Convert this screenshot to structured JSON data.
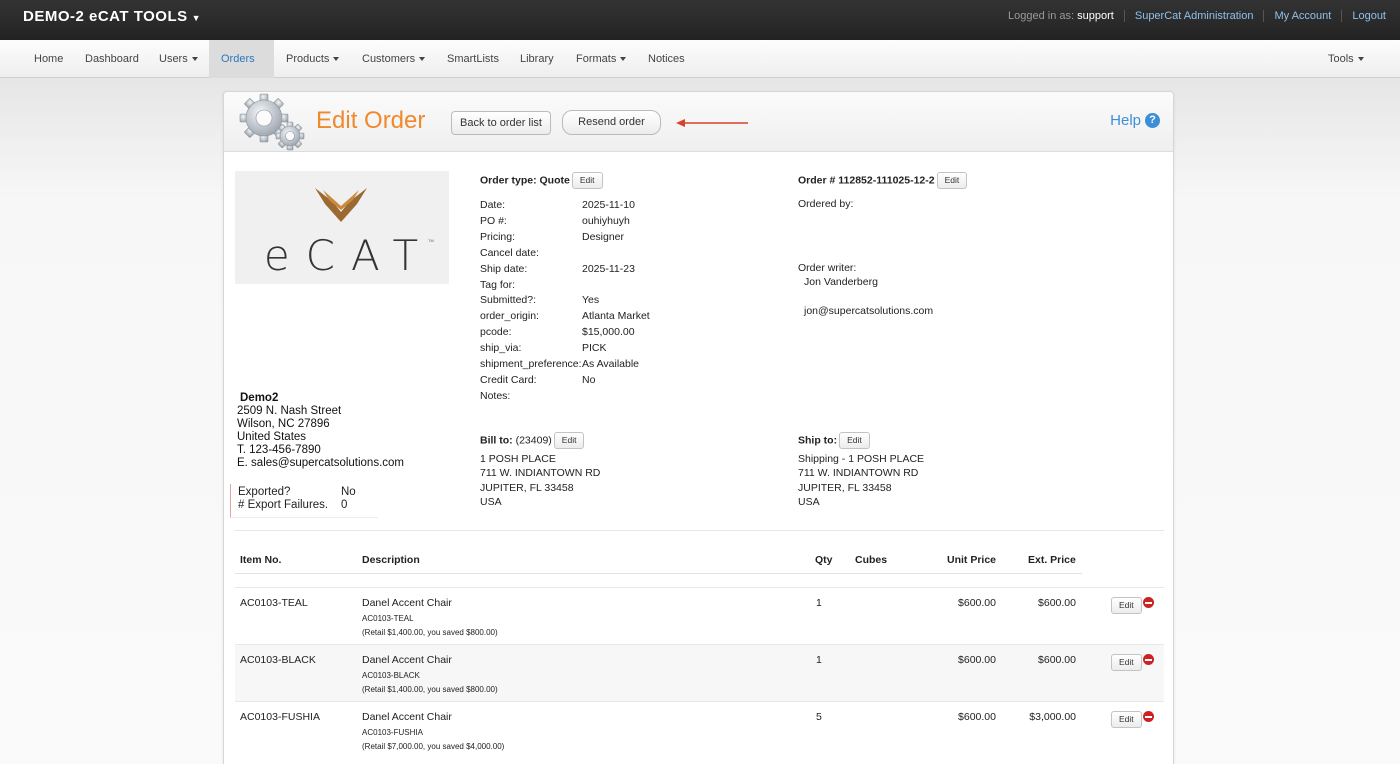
{
  "app": {
    "title": "DEMO-2 eCAT TOOLS"
  },
  "top_links": {
    "logged_in_prefix": "Logged in as:",
    "user": "support",
    "admin": "SuperCat Administration",
    "account": "My Account",
    "logout": "Logout"
  },
  "nav": {
    "home": "Home",
    "dashboard": "Dashboard",
    "users": "Users",
    "orders": "Orders",
    "products": "Products",
    "customers": "Customers",
    "smartlists": "SmartLists",
    "library": "Library",
    "formats": "Formats",
    "notices": "Notices",
    "tools": "Tools"
  },
  "header": {
    "title": "Edit Order",
    "back_label": "Back to order list",
    "resend_label": "Resend order",
    "help_label": "Help"
  },
  "logo": {
    "text": "eCAT",
    "tm": "TM"
  },
  "company": {
    "name": "Demo2",
    "street": "2509 N. Nash Street",
    "city": "Wilson, NC 27896",
    "country": "United States",
    "phone": "T. 123-456-7890",
    "email": "E. sales@supercatsolutions.com"
  },
  "export": {
    "exported_label": "Exported?",
    "exported_value": "No",
    "failures_label": "# Export Failures.",
    "failures_value": "0"
  },
  "order_type": {
    "label": "Order type: Quote",
    "edit": "Edit"
  },
  "details": [
    {
      "k": "Date:",
      "v": "2025-11-10"
    },
    {
      "k": "PO #:",
      "v": "ouhiyhuyh"
    },
    {
      "k": "Pricing:",
      "v": "Designer"
    },
    {
      "k": "Cancel date:",
      "v": ""
    },
    {
      "k": "Ship date:",
      "v": "2025-11-23"
    },
    {
      "k": "Tag for:",
      "v": ""
    },
    {
      "k": "Submitted?:",
      "v": "Yes"
    },
    {
      "k": "order_origin:",
      "v": "Atlanta Market"
    },
    {
      "k": "pcode:",
      "v": "$15,000.00"
    },
    {
      "k": "ship_via:",
      "v": "PICK"
    },
    {
      "k": "shipment_preference:",
      "v": "As Available"
    },
    {
      "k": "Credit Card:",
      "v": "No"
    },
    {
      "k": "Notes:",
      "v": ""
    }
  ],
  "order_num": {
    "label": "Order # 112852-111025-12-2",
    "edit": "Edit"
  },
  "ordered_by": {
    "label": "Ordered by:"
  },
  "order_writer": {
    "label": "Order writer:",
    "name": "Jon Vanderberg",
    "email": "jon@supercatsolutions.com"
  },
  "bill_to": {
    "label": "Bill to:",
    "account": "(23409)",
    "edit": "Edit",
    "line1": "1 POSH PLACE",
    "line2": "711 W. INDIANTOWN RD",
    "line3": "JUPITER, FL 33458",
    "line4": "USA"
  },
  "ship_to": {
    "label": "Ship to:",
    "edit": "Edit",
    "line1": "Shipping - 1 POSH PLACE",
    "line2": "711 W. INDIANTOWN RD",
    "line3": "JUPITER, FL 33458",
    "line4": "USA"
  },
  "table": {
    "headers": {
      "item": "Item No.",
      "desc": "Description",
      "qty": "Qty",
      "cubes": "Cubes",
      "unit": "Unit Price",
      "ext": "Ext. Price"
    },
    "edit_label": "Edit",
    "rows": [
      {
        "item": "AC0103-TEAL",
        "name": "Danel Accent Chair",
        "sku": "AC0103-TEAL",
        "retail": "(Retail $1,400.00, you saved $800.00)",
        "qty": "1",
        "cubes": "",
        "unit": "$600.00",
        "ext": "$600.00"
      },
      {
        "item": "AC0103-BLACK",
        "name": "Danel Accent Chair",
        "sku": "AC0103-BLACK",
        "retail": "(Retail $1,400.00, you saved $800.00)",
        "qty": "1",
        "cubes": "",
        "unit": "$600.00",
        "ext": "$600.00"
      },
      {
        "item": "AC0103-FUSHIA",
        "name": "Danel Accent Chair",
        "sku": "AC0103-FUSHIA",
        "retail": "(Retail $7,000.00, you saved $4,000.00)",
        "qty": "5",
        "cubes": "",
        "unit": "$600.00",
        "ext": "$3,000.00"
      }
    ]
  },
  "colors": {
    "accent_orange": "#ef8a2c",
    "link_blue": "#3a8fd6",
    "remove_red": "#cc2222",
    "annotation_arrow": "#d9412a"
  }
}
